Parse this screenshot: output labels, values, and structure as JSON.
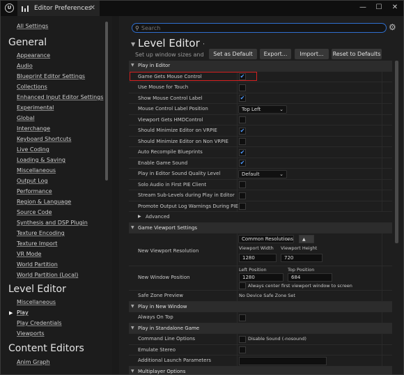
{
  "window": {
    "title": "Editor Preferences",
    "minimize": "—",
    "maximize": "☐",
    "close": "✕",
    "tab_close": "✕",
    "logo": "U"
  },
  "sidebar": {
    "all_settings": "All Settings",
    "sections": [
      {
        "title": "General",
        "items": [
          "Appearance",
          "Audio",
          "Blueprint Editor Settings",
          "Collections",
          "Enhanced Input Editor Settings",
          "Experimental",
          "Global",
          "Interchange",
          "Keyboard Shortcuts",
          "Live Coding",
          "Loading & Saving",
          "Miscellaneous",
          "Output Log",
          "Performance",
          "Region & Language",
          "Source Code",
          "Synthesis and DSP Plugin",
          "Texture Encoding",
          "Texture Import",
          "VR Mode",
          "World Partition",
          "World Partition (Local)"
        ]
      },
      {
        "title": "Level Editor",
        "items": [
          "Miscellaneous",
          "Play",
          "Play Credentials",
          "Viewports"
        ],
        "selected": "Play"
      },
      {
        "title": "Content Editors",
        "items": [
          "Anim Graph"
        ]
      }
    ]
  },
  "main": {
    "search": {
      "placeholder": "Search",
      "icon": "search-icon"
    },
    "header": {
      "title": "Level Editor - P",
      "subtitle": "Set up window sizes and oth",
      "collapse_icon": "▼"
    },
    "buttons": {
      "set_default": "Set as Default",
      "export": "Export...",
      "import": "Import...",
      "reset": "Reset to Defaults"
    },
    "categories": {
      "play_in_editor": "Play in Editor",
      "game_viewport": "Game Viewport Settings",
      "play_new_window": "Play in New Window",
      "standalone": "Play in Standalone Game",
      "multiplayer": "Multiplayer Options"
    },
    "pie_rows": [
      {
        "label": "Game Gets Mouse Control",
        "type": "checkbox",
        "checked": true
      },
      {
        "label": "Use Mouse for Touch",
        "type": "checkbox",
        "checked": false
      },
      {
        "label": "Show Mouse Control Label",
        "type": "checkbox",
        "checked": true
      },
      {
        "label": "Mouse Control Label Position",
        "type": "dropdown",
        "value": "Top Left"
      },
      {
        "label": "Viewport Gets HMDControl",
        "type": "checkbox",
        "checked": false
      },
      {
        "label": "Should Minimize Editor on VRPIE",
        "type": "checkbox",
        "checked": true
      },
      {
        "label": "Should Minimize Editor on Non VRPIE",
        "type": "checkbox",
        "checked": false
      },
      {
        "label": "Auto Recompile Blueprints",
        "type": "checkbox",
        "checked": true
      },
      {
        "label": "Enable Game Sound",
        "type": "checkbox",
        "checked": true
      },
      {
        "label": "Play in Editor Sound Quality Level",
        "type": "dropdown",
        "value": "Default"
      },
      {
        "label": "Solo Audio in First PIE Client",
        "type": "checkbox",
        "checked": false
      },
      {
        "label": "Stream Sub-Levels during Play in Editor",
        "type": "checkbox",
        "checked": false
      },
      {
        "label": "Promote Output Log Warnings During PIE",
        "type": "checkbox",
        "checked": false
      }
    ],
    "advanced": "Advanced",
    "viewport": {
      "new_viewport_resolution": "New Viewport Resolution",
      "common_resolutions": "Common Resolutions",
      "viewport_width_label": "Viewport Width",
      "viewport_height_label": "Viewport Height",
      "viewport_width": "1280",
      "viewport_height": "720",
      "new_window_position": "New Window Position",
      "left_position_label": "Left Position",
      "top_position_label": "Top Position",
      "left_position": "1280",
      "top_position": "684",
      "always_center": "Always center first viewport window to screen",
      "safe_zone_label": "Safe Zone Preview",
      "safe_zone_value": "No Device Safe Zone Set"
    },
    "new_window": {
      "always_on_top": "Always On Top"
    },
    "standalone_rows": {
      "command_line": "Command Line Options",
      "disable_sound": "Disable Sound (-nosound)",
      "emulate_stereo": "Emulate Stereo",
      "extra_params": "Additional Launch Parameters"
    }
  }
}
